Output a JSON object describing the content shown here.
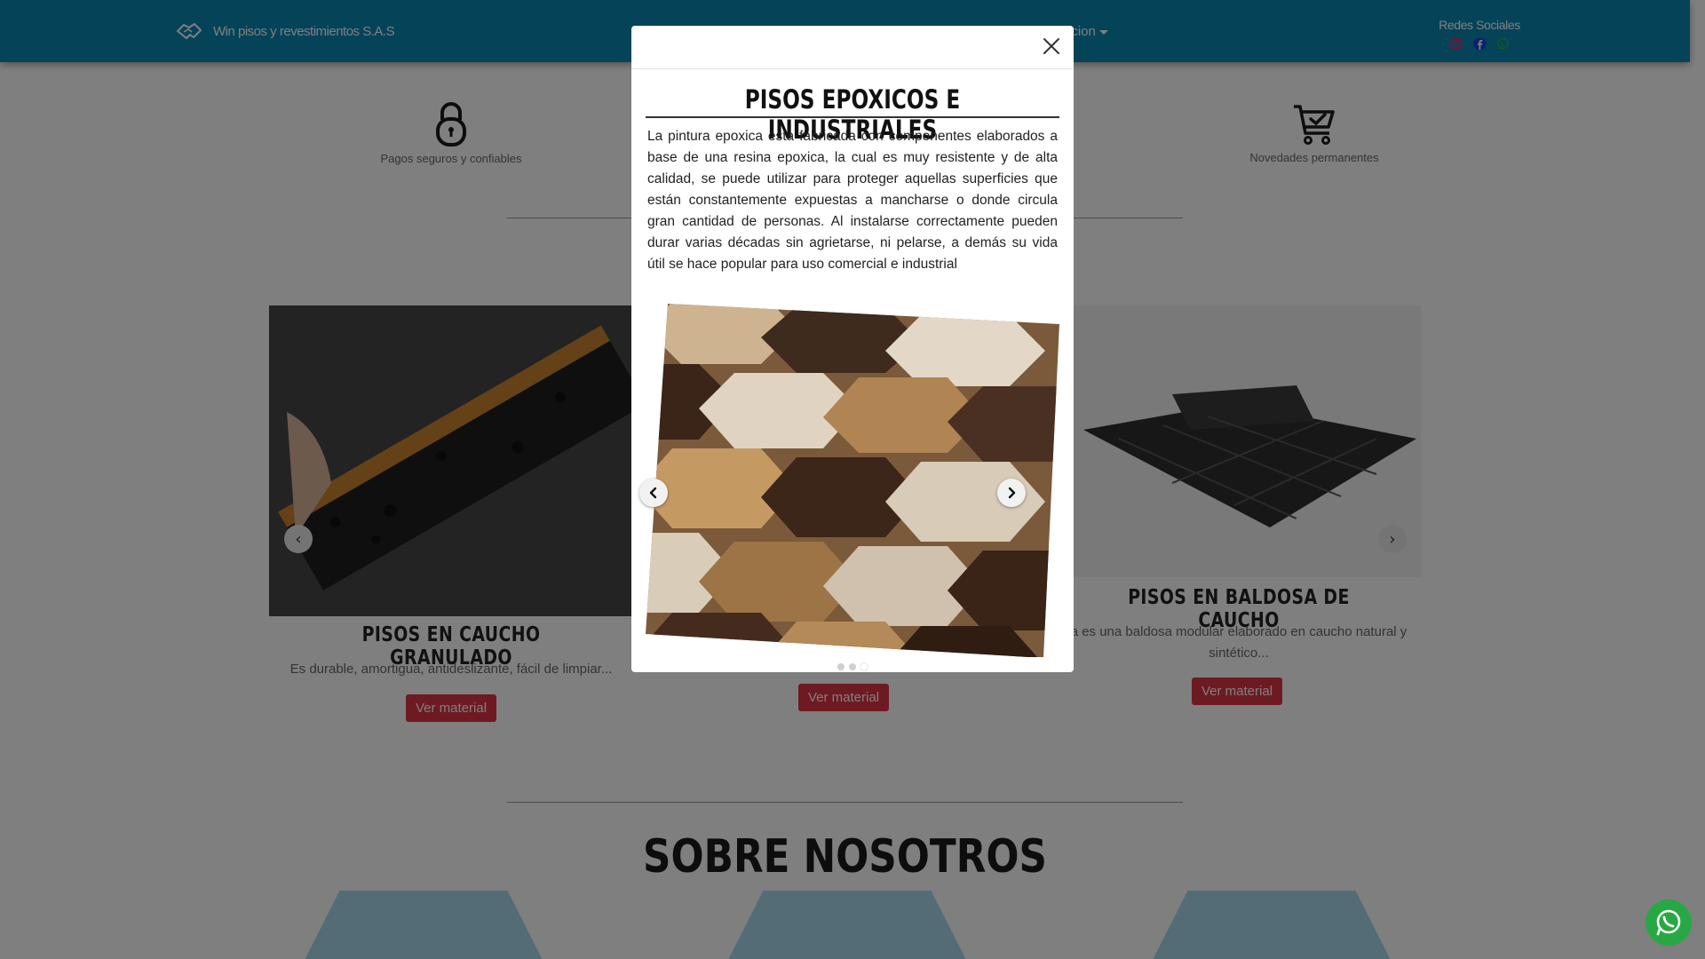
{
  "navbar": {
    "brand_text": "Win pisos y revestimientos S.A.S",
    "brand_icon": "handshake-icon",
    "dropdown_label_visible": "acion",
    "social_title": "Redes Sociales",
    "social_icons": [
      "instagram-icon",
      "facebook-icon",
      "whatsapp-icon"
    ]
  },
  "features": [
    {
      "label": "Pagos seguros y confiables",
      "icon": "padlock-icon"
    },
    {
      "label": "Novedades permanentes",
      "icon": "shopping-cart-check-icon"
    }
  ],
  "cards": [
    {
      "title": "PISOS EN CAUCHO GRANULADO",
      "description": "Es durable, amortigua, antideslizante, fácil de limpiar...",
      "button": "Ver material"
    },
    {
      "title": "",
      "description": "",
      "button": "Ver material"
    },
    {
      "title": "PISOS EN BALDOSA DE CAUCHO",
      "description_line1": "a es una baldosa modular elaborado en caucho natural y",
      "description_line2": "sintético...",
      "button": "Ver material"
    }
  ],
  "about": {
    "title": "SOBRE NOSOTROS"
  },
  "modal": {
    "title": "PISOS EPOXICOS E INDUSTRIALES",
    "body": "La pintura epoxica esta fabricada con componentes elaborados a base de una resina epoxica, la cual es muy resistente y de alta calidad, se puede utilizar para proteger aquellas superficies que están constantemente expuestas a mancharse o donde circula gran cantidad de personas. Al instalarse correctamente pueden durar varias décadas sin agrietarse, ni pelarse, a demás su vida útil se hace popular para uso comercial e industrial",
    "close_icon": "close-icon",
    "carousel": {
      "slide_count": 3,
      "active_index": 2
    }
  },
  "colors": {
    "navbar": "#0a86b0",
    "button": "#dc3545",
    "whatsapp": "#27a844",
    "hexagon": "#a7d8ec"
  }
}
